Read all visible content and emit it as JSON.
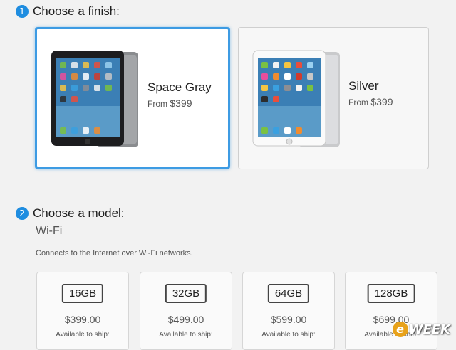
{
  "step1": {
    "number": "1",
    "title": "Choose a finish:"
  },
  "finishes": [
    {
      "name": "Space Gray",
      "from": "From",
      "price": "$399",
      "selected": true
    },
    {
      "name": "Silver",
      "from": "From",
      "price": "$399",
      "selected": false
    }
  ],
  "step2": {
    "number": "2",
    "title": "Choose a model:"
  },
  "model": {
    "label": "Wi-Fi",
    "description": "Connects to the Internet over Wi-Fi networks."
  },
  "capacities": [
    {
      "size": "16GB",
      "price": "$399.00",
      "ship": "Available to ship:"
    },
    {
      "size": "32GB",
      "price": "$499.00",
      "ship": "Available to ship:"
    },
    {
      "size": "64GB",
      "price": "$599.00",
      "ship": "Available to ship:"
    },
    {
      "size": "128GB",
      "price": "$699.00",
      "ship": "Available to ship:"
    }
  ],
  "watermark": {
    "letter": "e",
    "text": "WEEK"
  },
  "colors": {
    "accent": "#3d9be3",
    "step_badge": "#1f8de0",
    "background": "#f2f2f2"
  }
}
